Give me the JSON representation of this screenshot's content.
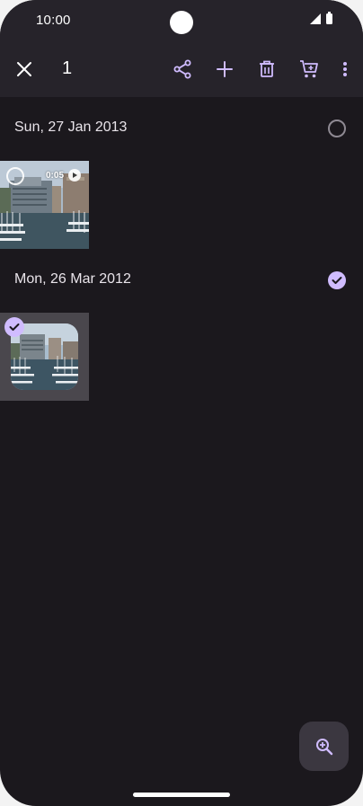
{
  "status_bar": {
    "time": "10:00",
    "icons": [
      "signal-icon",
      "battery-icon"
    ]
  },
  "action_bar": {
    "selected_count": "1",
    "icons": [
      "close-icon",
      "share-icon",
      "add-icon",
      "delete-icon",
      "cart-icon",
      "more-vert-icon"
    ]
  },
  "groups": [
    {
      "date": "Sun, 27 Jan 2013",
      "selected": false,
      "items": [
        {
          "type": "video",
          "duration": "0:05",
          "selected": false
        }
      ]
    },
    {
      "date": "Mon, 26 Mar 2012",
      "selected": true,
      "items": [
        {
          "type": "photo",
          "selected": true
        }
      ]
    }
  ],
  "fab": {
    "icon": "zoom-in-icon"
  },
  "colors": {
    "background": "#1b181d",
    "bar": "#26232a",
    "accent": "#d0bcff",
    "selected_tile": "#4a474d"
  }
}
